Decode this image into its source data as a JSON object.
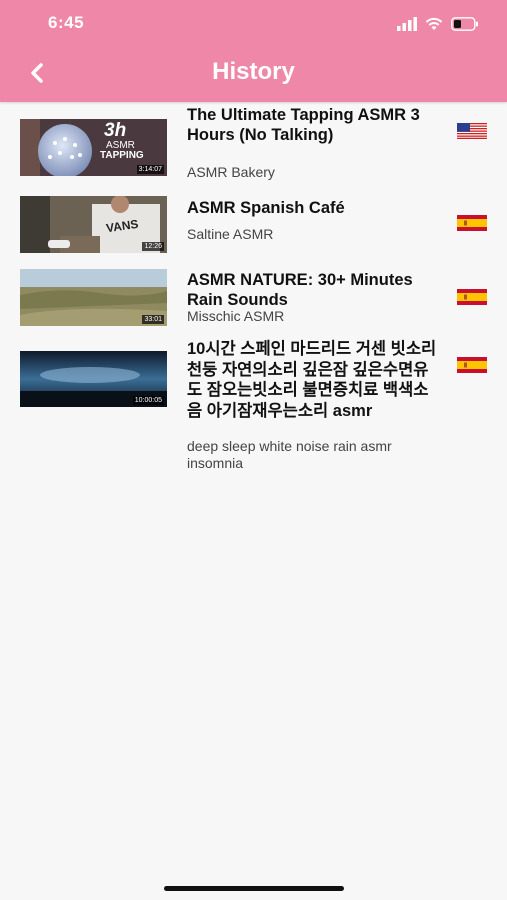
{
  "status_bar": {
    "time": "6:45"
  },
  "header": {
    "title": "History"
  },
  "videos": [
    {
      "title": "The Ultimate Tapping ASMR 3 Hours (No Talking)",
      "channel": "ASMR Bakery",
      "duration": "3:14:07",
      "thumb_text": "3h",
      "thumb_text2": "ASMR",
      "thumb_text3": "TAPPING",
      "flag": "us-flag-icon"
    },
    {
      "title": "ASMR Spanish Café",
      "channel": "Saltine ASMR",
      "duration": "12:26",
      "thumb_brand": "VANS",
      "flag": "spain-flag-icon"
    },
    {
      "title": "ASMR NATURE: 30+ Minutes Rain Sounds",
      "channel": "Misschic ASMR",
      "duration": "33:01",
      "flag": "spain-flag-icon"
    },
    {
      "title": "10시간 스페인 마드리드 거센 빗소리 천둥 자연의소리 깊은잠 깊은수면유도 잠오는빗소리 불면증치료 백색소음 아기잠재우는소리 asmr",
      "channel": "deep sleep white noise rain asmr insomnia",
      "duration": "10:00:05",
      "flag": "spain-flag-icon"
    }
  ],
  "colors": {
    "header": "#ef88a8",
    "background": "#f7f7f7"
  }
}
